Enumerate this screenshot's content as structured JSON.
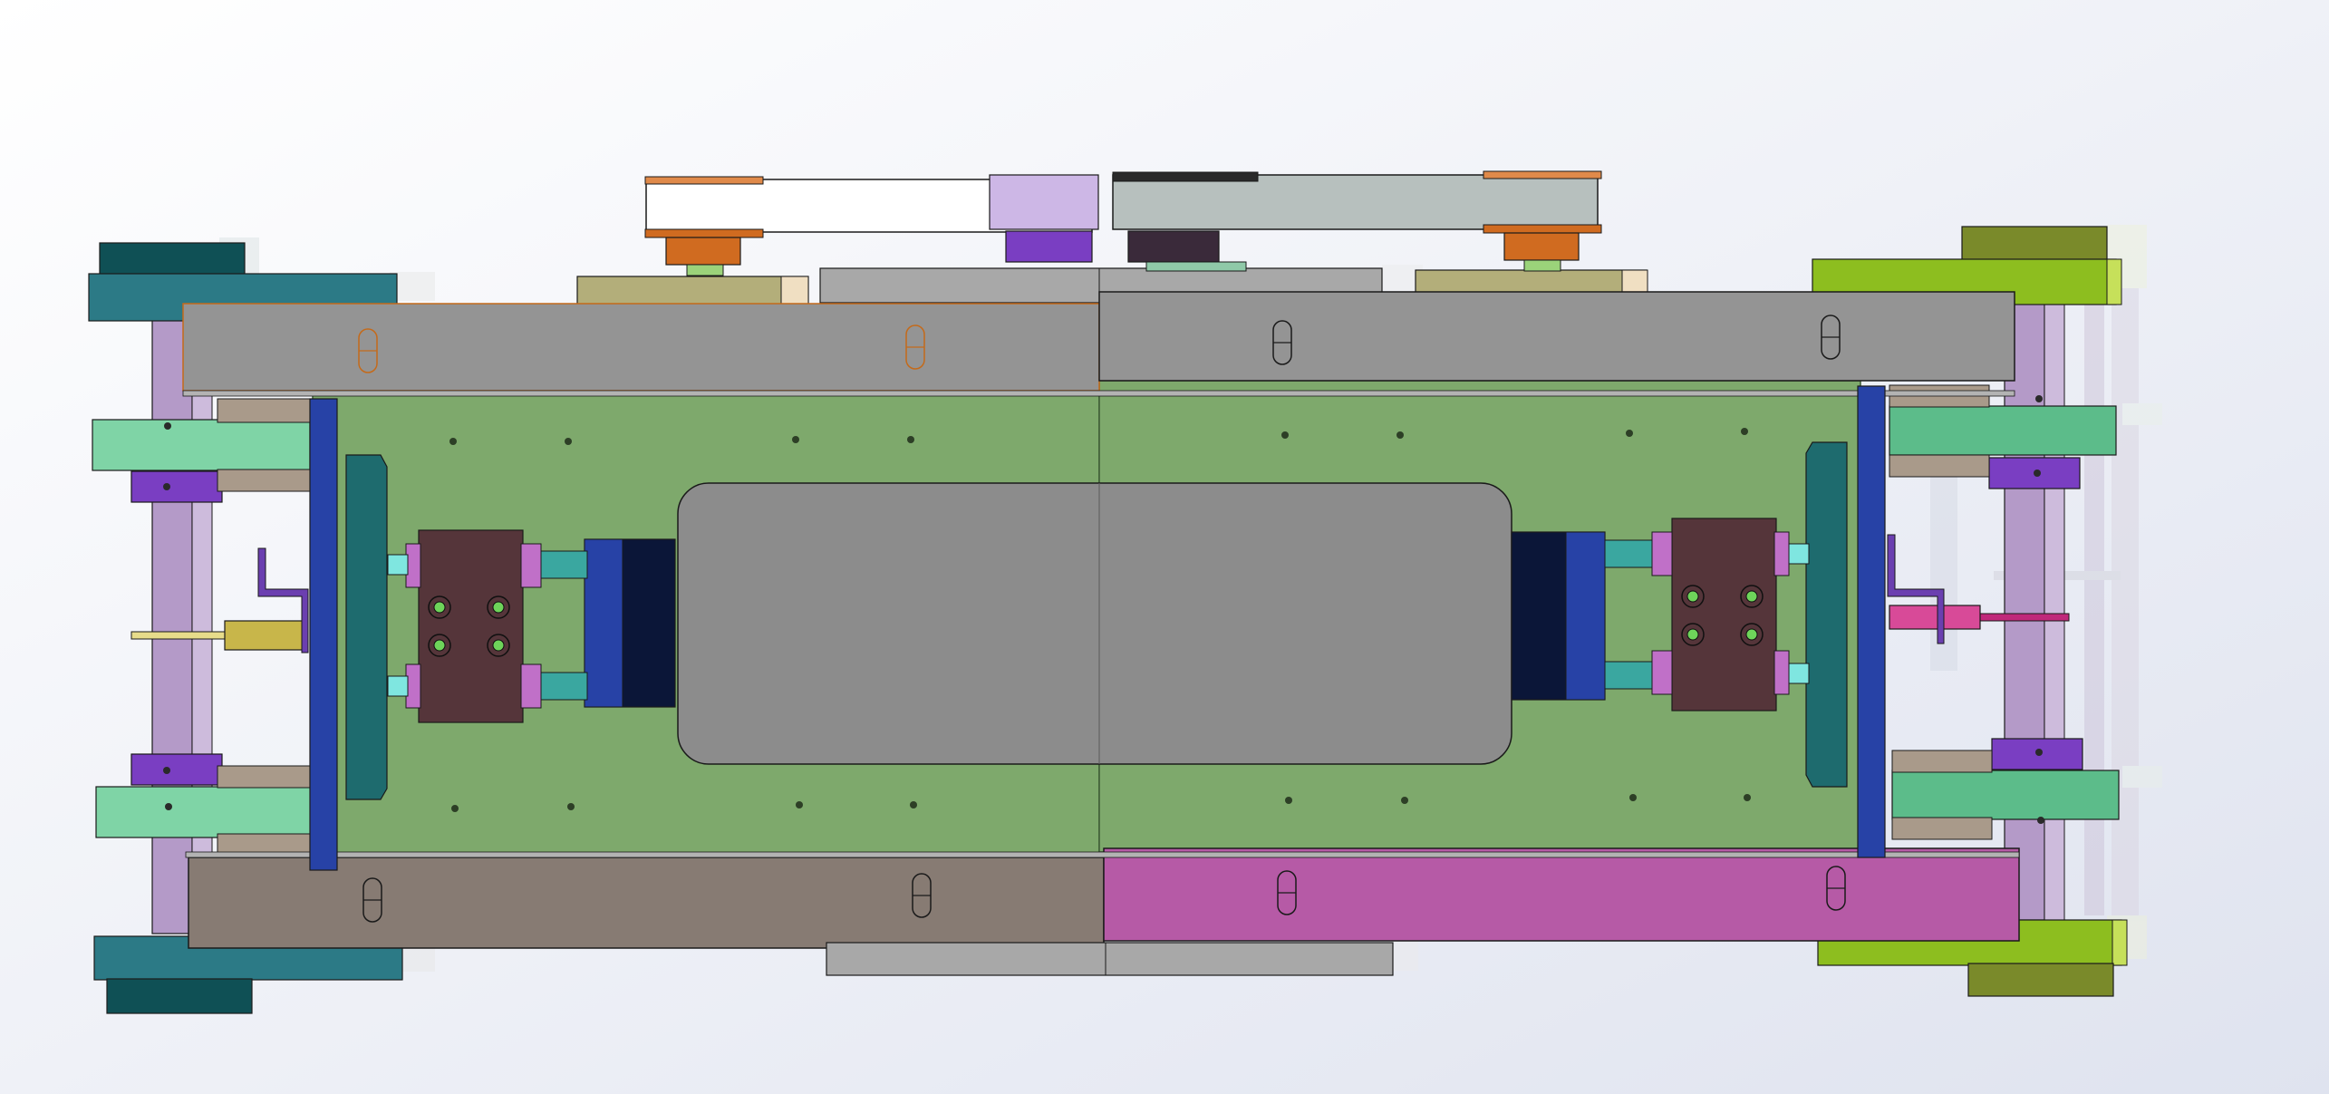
{
  "viewport": {
    "background_top": "#ffffff",
    "background_bottom": "#dfe3ef"
  },
  "colors": {
    "base_plate": "#7ea96c",
    "base_plate_stroke": "#3d5a34",
    "rail_gray": "#949494",
    "rail_gray_light": "#b3b3b3",
    "rail_taupe": "#877b73",
    "rail_magenta": "#b65aa6",
    "center_panel": "#8c8c8c",
    "frame_blue": "#2742a6",
    "teal_plate": "#1e6b6e",
    "dark_teal": "#0f5055",
    "block_brown": "#55353a",
    "lime": "#8dbe1f",
    "olive": "#7a8a2a",
    "mint": "#5cbc8a",
    "purple": "#7a3ec2",
    "lavender": "#b49ac8",
    "orange": "#d06b20",
    "tan": "#b3ae7a",
    "white_belt": "#ffffff",
    "gray_belt": "#b7c0be",
    "spring_teal": "#3aa7a0",
    "navy_block": "#0b1638",
    "pink_rod": "#c0287a",
    "brass_rod": "#c8b64a",
    "outline": "#1a1a1a"
  },
  "icons": {
    "slot_hole": "slot-hole-icon",
    "bolt_hole": "bolt-hole-icon"
  }
}
